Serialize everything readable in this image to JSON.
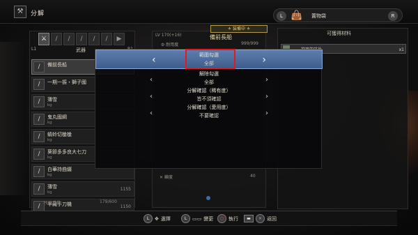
{
  "header": {
    "title": "分解",
    "right_label": "置物袋",
    "btn_left": "L",
    "btn_right": "R"
  },
  "left_panel": {
    "tab_label": "武器",
    "l1": "L1",
    "r1": "R1",
    "tabs": [
      "⚔",
      "/",
      "/",
      "/",
      "/",
      "/",
      "▶"
    ],
    "items": [
      {
        "name": "備前長船",
        "sub": "",
        "count": "",
        "selected": true
      },
      {
        "name": "一期一振・獅子國",
        "sub": "",
        "count": "",
        "selected": false
      },
      {
        "name": "薄雪",
        "sub": "kg",
        "count": "",
        "selected": false
      },
      {
        "name": "鬼丸國綱",
        "sub": "kg",
        "count": "",
        "selected": false
      },
      {
        "name": "蜻蛉切槍槍",
        "sub": "kg",
        "count": "",
        "selected": false
      },
      {
        "name": "葵節多多良大七刀",
        "sub": "kg",
        "count": "",
        "selected": false
      },
      {
        "name": "白華持曲纒",
        "sub": "kg",
        "count": "",
        "selected": false
      },
      {
        "name": "薄雪",
        "sub": "kg",
        "count": "1155",
        "selected": false
      },
      {
        "name": "半藏手刀機",
        "sub": "",
        "count": "1150",
        "selected": false
      }
    ],
    "footer_label": "所持重量",
    "footer_value": "179/600"
  },
  "mid_panel": {
    "level": "LV 170(+16)",
    "weapon_name": "備前長船",
    "equipped": "⚜ 装備中 ⚜",
    "stat_label": "⚙ 耐用度",
    "stat_value": "999/999",
    "bottom_label": "✕ 練度",
    "bottom_value": "40"
  },
  "right_panel": {
    "title": "可獲得材料",
    "material_name": "神器的碎片",
    "material_count": "x1"
  },
  "dialog": {
    "rows": [
      {
        "label": "範圍勾選",
        "value": "全部",
        "highlighted": true
      },
      {
        "label": "解除勾選",
        "value": "全部",
        "highlighted": false
      },
      {
        "label": "分解確認（稀有度）",
        "value": "皆不須確認",
        "highlighted": false
      },
      {
        "label": "分解確認（愛用度）",
        "value": "不要確認",
        "highlighted": false
      }
    ]
  },
  "footer": {
    "hints": [
      {
        "button": "L",
        "icon": "✥",
        "label": "選擇"
      },
      {
        "button": "L",
        "icon": "▭▭",
        "label": "變更"
      },
      {
        "button": "○",
        "icon": "",
        "label": "執行"
      },
      {
        "button": "▬",
        "icon": "✕",
        "label": "返回"
      }
    ]
  },
  "colors": {
    "highlight_bar": "#5d7eae",
    "red_marker": "#e01b1b",
    "gold_text": "#e6d7a8"
  }
}
